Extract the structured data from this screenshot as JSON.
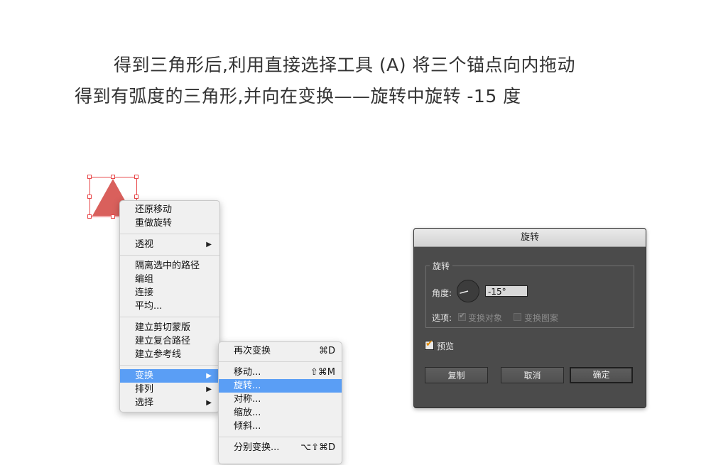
{
  "caption": {
    "line1": "得到三角形后,利用直接选择工具 (A) 将三个锚点向内拖动",
    "line2": "得到有弧度的三角形,并向在变换——旋转中旋转 -15 度"
  },
  "colors": {
    "triangle": "#d9605c",
    "selection": "#e8484a",
    "highlight": "#5a9ef5",
    "dialog_bg": "#4b4b4b",
    "preview_check": "#e08a00"
  },
  "context_menu": {
    "groups": [
      [
        {
          "label": "还原移动"
        },
        {
          "label": "重做旋转"
        }
      ],
      [
        {
          "label": "透视",
          "submenu": true
        }
      ],
      [
        {
          "label": "隔离选中的路径"
        },
        {
          "label": "编组"
        },
        {
          "label": "连接"
        },
        {
          "label": "平均..."
        }
      ],
      [
        {
          "label": "建立剪切蒙版"
        },
        {
          "label": "建立复合路径"
        },
        {
          "label": "建立参考线"
        }
      ],
      [
        {
          "label": "变换",
          "submenu": true,
          "active": true
        },
        {
          "label": "排列",
          "submenu": true
        },
        {
          "label": "选择",
          "submenu": true
        }
      ]
    ],
    "arrow_glyph": "▶"
  },
  "transform_submenu": {
    "groups": [
      [
        {
          "label": "再次变换",
          "shortcut": "⌘D"
        }
      ],
      [
        {
          "label": "移动...",
          "shortcut": "⇧⌘M"
        },
        {
          "label": "旋转...",
          "active": true
        },
        {
          "label": "对称..."
        },
        {
          "label": "缩放..."
        },
        {
          "label": "倾斜..."
        }
      ],
      [
        {
          "label": "分别变换...",
          "shortcut": "⌥⇧⌘D"
        }
      ]
    ]
  },
  "rotate_dialog": {
    "title": "旋转",
    "group_label": "旋转",
    "angle_label": "角度:",
    "angle_value": "-15°",
    "angle_degrees": -15,
    "options_label": "选项:",
    "option_objects": {
      "label": "变换对象",
      "checked": true,
      "enabled": false
    },
    "option_patterns": {
      "label": "变换图案",
      "checked": false,
      "enabled": false
    },
    "preview": {
      "label": "预览",
      "checked": true
    },
    "buttons": {
      "copy": "复制",
      "cancel": "取消",
      "ok": "确定"
    }
  }
}
